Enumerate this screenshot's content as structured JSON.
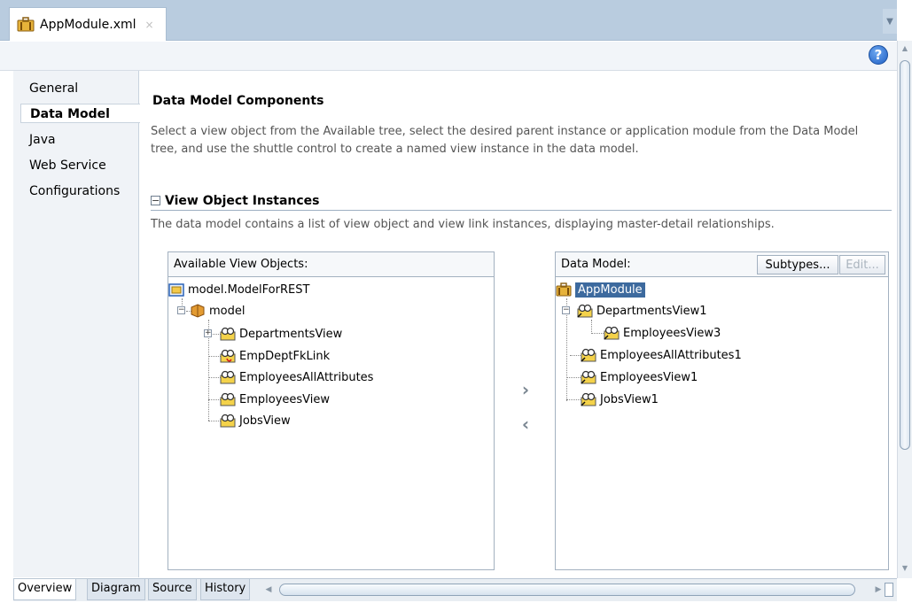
{
  "editor_tab": {
    "title": "AppModule.xml",
    "close": "×"
  },
  "help": {
    "glyph": "?"
  },
  "nav": {
    "items": [
      "General",
      "Data Model",
      "Java",
      "Web Service",
      "Configurations"
    ],
    "selected": "Data Model"
  },
  "main": {
    "title": "Data Model Components",
    "description": "Select a view object from the Available tree, select the desired parent instance or application module from the Data Model tree, and use the shuttle control to create a named view instance in the data model.",
    "section_title": "View Object Instances",
    "section_description": "The data model contains a list of view object and view link instances, displaying master-detail relationships."
  },
  "available": {
    "header": "Available View Objects:",
    "root": "model.ModelForREST",
    "package": "model",
    "items": [
      "DepartmentsView",
      "EmpDeptFkLink",
      "EmployeesAllAttributes",
      "EmployeesView",
      "JobsView"
    ]
  },
  "shuttle": {
    "add": "›",
    "remove": "‹"
  },
  "data_model": {
    "header": "Data Model:",
    "subtypes_label": "Subtypes...",
    "edit_label": "Edit...",
    "root": "AppModule",
    "items": [
      "DepartmentsView1",
      "EmployeesView3",
      "EmployeesAllAttributes1",
      "EmployeesView1",
      "JobsView1"
    ]
  },
  "bottom_tabs": [
    "Overview",
    "Diagram",
    "Source",
    "History"
  ],
  "colors": {
    "accent": "#3d6a9e",
    "selection": "#3d6a9e",
    "tab_strip": "#b9ccdf"
  }
}
